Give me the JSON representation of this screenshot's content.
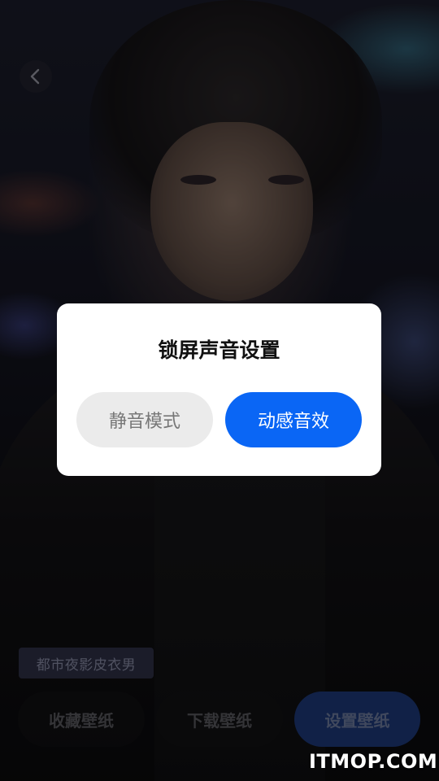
{
  "dialog": {
    "title": "锁屏声音设置",
    "buttons": {
      "mute": "静音模式",
      "dynamic": "动感音效"
    }
  },
  "wallpaper": {
    "tag": "都市夜影皮衣男"
  },
  "actions": {
    "collect": "收藏壁纸",
    "download": "下载壁纸",
    "set": "设置壁纸"
  },
  "watermark": "ITMOP.COM",
  "icons": {
    "back": "chevron-left-icon"
  },
  "colors": {
    "primary": "#0a66f5",
    "dialog_bg": "#ffffff",
    "mute_bg": "#ebebeb",
    "set_button_bg": "#1e3a7a"
  }
}
